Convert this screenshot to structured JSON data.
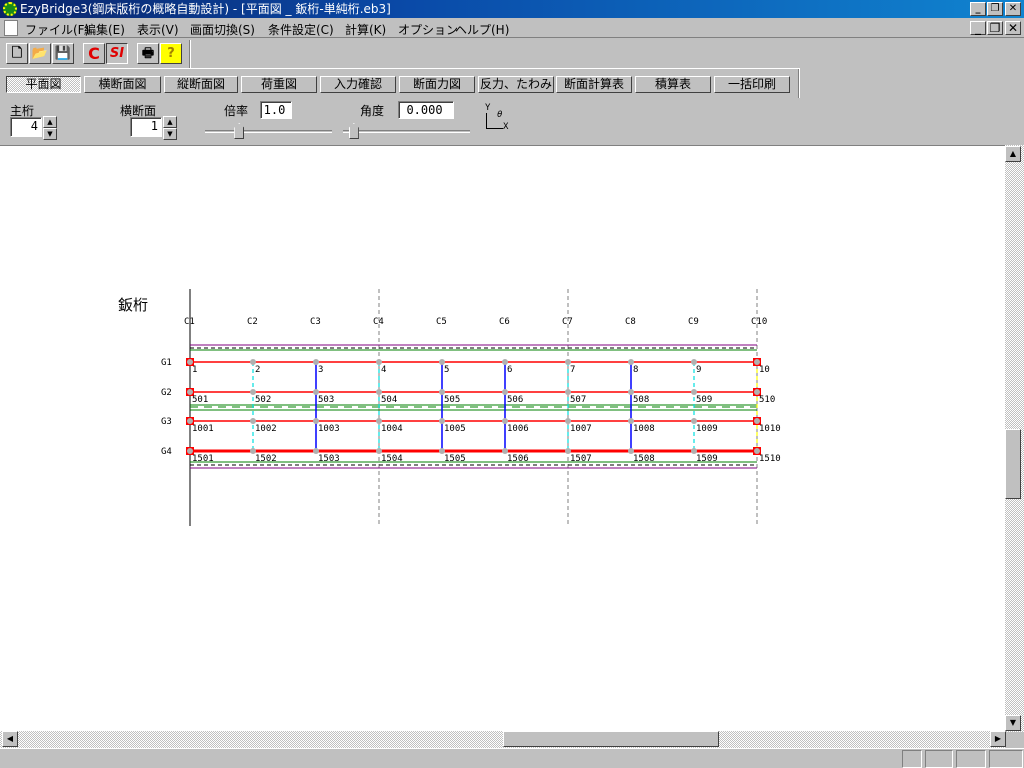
{
  "window": {
    "title": "EzyBridge3(鋼床版桁の概略自動設計) - [平面図 _ 鈑桁-単純桁.eb3]",
    "min": "_",
    "restore": "❐",
    "close": "✕"
  },
  "menu": [
    "ファイル(F)",
    "編集(E)",
    "表示(V)",
    "画面切換(S)",
    "条件設定(C)",
    "計算(K)",
    "オプション",
    "ヘルプ(H)"
  ],
  "toolbar": [
    {
      "icon": "new-icon",
      "glyph": "🗋"
    },
    {
      "icon": "open-icon",
      "glyph": "📂"
    },
    {
      "icon": "save-icon",
      "glyph": "💾"
    },
    {
      "icon": "c-unit-icon",
      "glyph": "C"
    },
    {
      "icon": "si-unit-icon",
      "glyph": "SI"
    },
    {
      "icon": "print-icon",
      "glyph": "🖶"
    },
    {
      "icon": "help-icon",
      "glyph": "?"
    }
  ],
  "tabs": [
    "平面図",
    "横断面図",
    "縦断面図",
    "荷重図",
    "入力確認",
    "断面力図",
    "反力、たわみ",
    "断面計算表",
    "積算表",
    "一括印刷"
  ],
  "controls": {
    "girder_label": "主桁",
    "girder_value": "4",
    "section_label": "横断面",
    "section_value": "1",
    "scale_label": "倍率",
    "scale_value": "1.0",
    "angle_label": "角度",
    "angle_value": "0.000",
    "axis_y": "Y",
    "axis_x": "X",
    "axis_theta": "θ",
    "scale_slider": 0.25,
    "angle_slider": 0.05
  },
  "drawing": {
    "title": "鈑桁",
    "cross_beams": [
      "C1",
      "C2",
      "C3",
      "C4",
      "C5",
      "C6",
      "C7",
      "C8",
      "C9",
      "C10"
    ],
    "girders": [
      "G1",
      "G2",
      "G3",
      "G4"
    ],
    "nodes": [
      [
        "1",
        "2",
        "3",
        "4",
        "5",
        "6",
        "7",
        "8",
        "9",
        "10"
      ],
      [
        "501",
        "502",
        "503",
        "504",
        "505",
        "506",
        "507",
        "508",
        "509",
        "510"
      ],
      [
        "1001",
        "1002",
        "1003",
        "1004",
        "1005",
        "1006",
        "1007",
        "1008",
        "1009",
        "1010"
      ],
      [
        "1501",
        "1502",
        "1503",
        "1504",
        "1505",
        "1506",
        "1507",
        "1508",
        "1509",
        "1510"
      ]
    ],
    "beam_types": [
      "support",
      "cyan",
      "blue",
      "cyan",
      "blue",
      "blue",
      "cyan",
      "blue",
      "cyan",
      "yellow"
    ],
    "colors": {
      "girder": "#ff0000",
      "blue": "#0000ff",
      "cyan": "#00e0e0",
      "yellow": "#ffff00",
      "green": "#008000",
      "purple": "#800080",
      "node": "#b0b0b0"
    }
  }
}
